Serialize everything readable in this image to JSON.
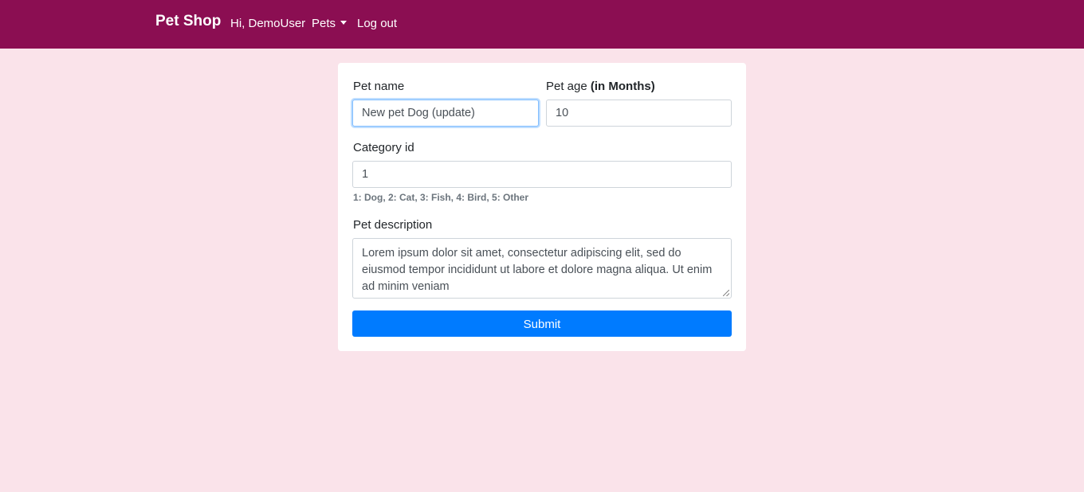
{
  "navbar": {
    "brand": "Pet Shop",
    "greeting": "Hi, DemoUser",
    "pets_menu": "Pets",
    "logout": "Log out"
  },
  "form": {
    "pet_name": {
      "label": "Pet name",
      "value": "New pet Dog (update)"
    },
    "pet_age": {
      "label": "Pet age",
      "label_bold": "(in Months)",
      "value": "10"
    },
    "category_id": {
      "label": "Category id",
      "value": "1",
      "help": "1: Dog, 2: Cat, 3: Fish, 4: Bird, 5: Other"
    },
    "pet_description": {
      "label": "Pet description",
      "value": "Lorem ipsum dolor sit amet, consectetur adipiscing elit, sed do eiusmod tempor incididunt ut labore et dolore magna aliqua. Ut enim ad minim veniam"
    },
    "submit_label": "Submit"
  },
  "colors": {
    "navbar_bg": "#8b0e52",
    "page_bg": "#fae3ea",
    "primary_button": "#007bff"
  }
}
